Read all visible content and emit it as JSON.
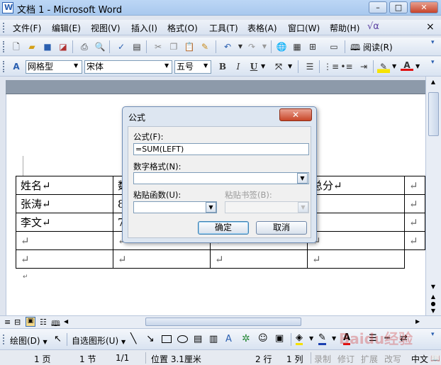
{
  "window": {
    "title": "文档 1 - Microsoft Word",
    "min": "–",
    "max": "□",
    "close": "✕"
  },
  "menu": [
    "文件(F)",
    "编辑(E)",
    "视图(V)",
    "插入(I)",
    "格式(O)",
    "工具(T)",
    "表格(A)",
    "窗口(W)",
    "帮助(H)"
  ],
  "menu_close": "×",
  "toolbar1": {
    "read_label": "阅读(R)"
  },
  "toolbar2": {
    "style": "网格型",
    "font": "宋体",
    "size": "五号",
    "bold": "B",
    "italic": "I",
    "underline": "U"
  },
  "table": {
    "rows": [
      [
        "姓名↵",
        "数",
        "",
        "总分↵",
        "↵"
      ],
      [
        "张涛↵",
        "8",
        "",
        "",
        "↵"
      ],
      [
        "李文↵",
        "7",
        "",
        "",
        "↵"
      ],
      [
        "↵",
        "↵",
        "↵",
        "↵",
        "↵"
      ],
      [
        "↵",
        "↵",
        "↵",
        "↵",
        ""
      ]
    ],
    "after_mark": "↵"
  },
  "dialog": {
    "title": "公式",
    "close": "✕",
    "formula_label": "公式(F):",
    "formula_value": "=SUM(LEFT)",
    "number_format_label": "数字格式(N):",
    "number_format_value": "",
    "paste_function_label": "粘贴函数(U):",
    "paste_function_value": "",
    "paste_bookmark_label": "粘贴书签(B):",
    "paste_bookmark_value": "",
    "ok": "确定",
    "cancel": "取消"
  },
  "drawbar": {
    "draw": "绘图(D)",
    "autoshapes": "自选图形(U)"
  },
  "status": {
    "page": "1 页",
    "section": "1 节",
    "pages": "1/1",
    "position": "位置 3.1厘米",
    "line": "2 行",
    "column": "1 列",
    "rec": "录制",
    "trk": "修订",
    "ext": "扩展",
    "ovr": "改写",
    "lang": "中文"
  },
  "watermark": "Baidu经验",
  "colors": {
    "titlebar": "#a8c8ee",
    "ruler": "#8d9aaa",
    "dialog_bg": "#dde6f1",
    "close_red": "#c84628"
  }
}
